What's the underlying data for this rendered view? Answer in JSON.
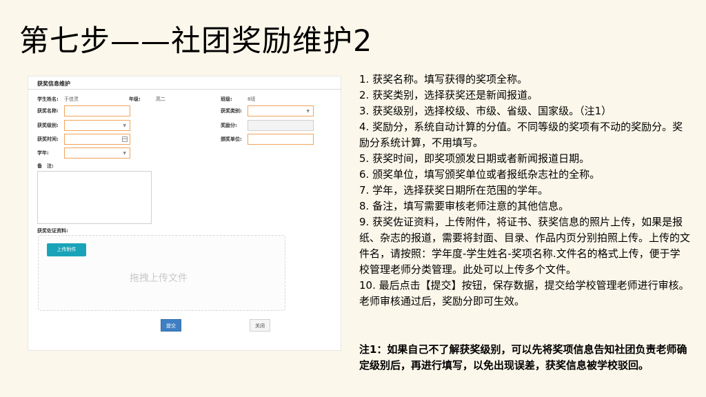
{
  "slide": {
    "title": "第七步——社团奖励维护2"
  },
  "form": {
    "header": "获奖信息维护",
    "student_label": "学生姓名:",
    "student_value": "于佳灵",
    "grade_label": "年级:",
    "grade_value": "高二",
    "class_label": "班级:",
    "class_value": "8班",
    "award_name_label": "获奖名称:",
    "award_type_label": "获奖类别:",
    "award_level_label": "获奖级别:",
    "reward_points_label": "奖励分:",
    "award_time_label": "获奖时间:",
    "issuer_label": "颁奖单位:",
    "school_year_label": "学年:",
    "remarks_label": "备　注:",
    "evidence_label": "获奖佐证资料:",
    "upload_button": "上传附件",
    "drag_text": "拖拽上传文件",
    "submit_button": "提交",
    "close_button": "关闭"
  },
  "instructions": [
    "1. 获奖名称。填写获得的奖项全称。",
    "2. 获奖类别，选择获奖还是新闻报道。",
    "3. 获奖级别，选择校级、市级、省级、国家级。（注1）",
    "4. 奖励分，系统自动计算的分值。不同等级的奖项有不动的奖励分。奖励分系统计算，不用填写。",
    "5. 获奖时间，即奖项颁发日期或者新闻报道日期。",
    "6. 颁奖单位，填写颁奖单位或者报纸杂志社的全称。",
    "7. 学年，选择获奖日期所在范围的学年。",
    "8. 备注，填写需要审核老师注意的其他信息。",
    "9. 获奖佐证资料，上传附件，将证书、获奖信息的照片上传，如果是报纸、杂志的报道，需要将封面、目录、作品内页分别拍照上传。上传的文件名，请按照：学年度-学生姓名-奖项名称.文件名的格式上传，便于学校管理老师分类管理。此处可以上传多个文件。",
    "10. 最后点击【提交】按钮，保存数据，提交给学校管理老师进行审核。老师审核通过后，奖励分即可生效。"
  ],
  "note": "注1：如果自己不了解获奖级别，可以先将奖项信息告知社团负责老师确定级别后，再进行填写，以免出现误差，获奖信息被学校驳回。"
}
